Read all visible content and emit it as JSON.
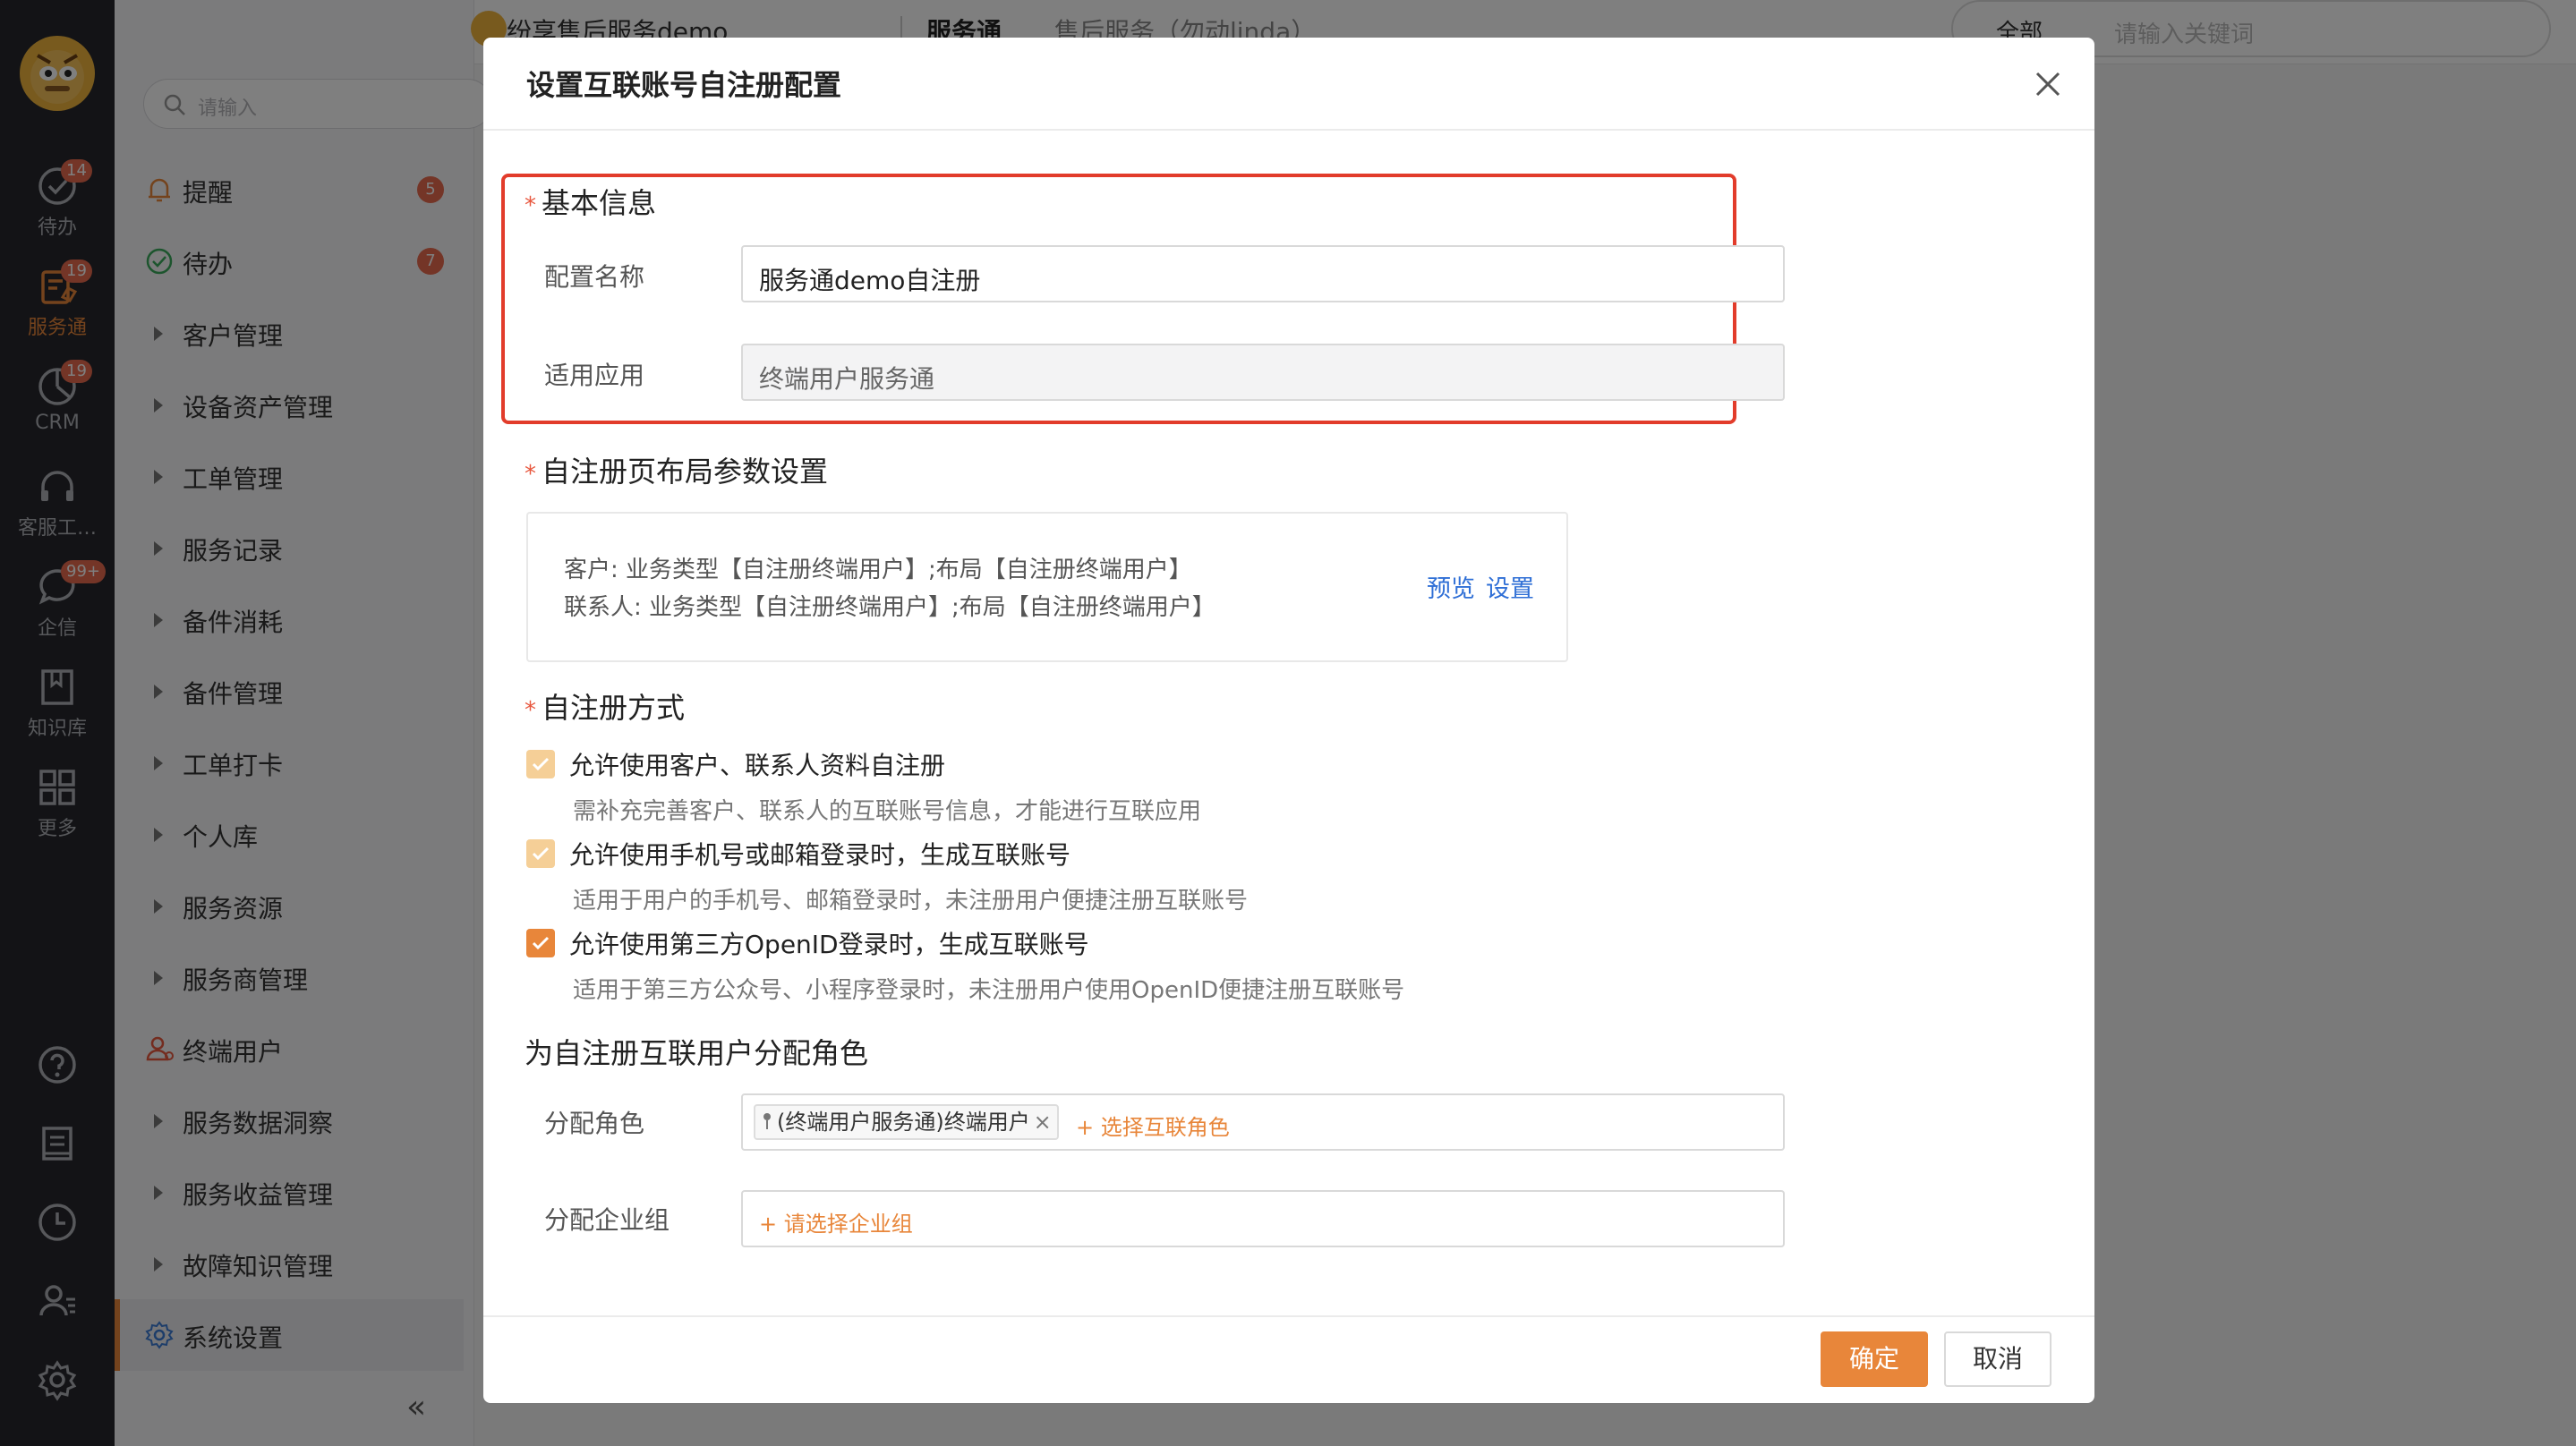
{
  "rail": {
    "items": [
      {
        "label": "待办",
        "badge": "14",
        "icon": "check-circle-icon"
      },
      {
        "label": "服务通",
        "badge": "19",
        "icon": "service-icon",
        "active": true
      },
      {
        "label": "CRM",
        "badge": "19",
        "icon": "pie-chart-icon"
      },
      {
        "label": "客服工…",
        "badge": "",
        "icon": "headset-icon"
      },
      {
        "label": "企信",
        "badge": "99+",
        "icon": "chat-bubble-icon"
      },
      {
        "label": "知识库",
        "badge": "",
        "icon": "book-icon"
      },
      {
        "label": "更多",
        "badge": "",
        "icon": "grid-icon"
      }
    ],
    "tools": [
      "help-icon",
      "notebook-icon",
      "clock-icon",
      "user-settings-icon",
      "gear-icon"
    ]
  },
  "side": {
    "search_placeholder": "请输入",
    "items": [
      {
        "label": "提醒",
        "badge": "5",
        "icon": "bell-icon"
      },
      {
        "label": "待办",
        "badge": "7",
        "icon": "check-circle-icon"
      },
      {
        "label": "客户管理"
      },
      {
        "label": "设备资产管理"
      },
      {
        "label": "工单管理"
      },
      {
        "label": "服务记录"
      },
      {
        "label": "备件消耗"
      },
      {
        "label": "备件管理"
      },
      {
        "label": "工单打卡"
      },
      {
        "label": "个人库"
      },
      {
        "label": "服务资源"
      },
      {
        "label": "服务商管理"
      },
      {
        "label": "终端用户",
        "icon": "user-icon"
      },
      {
        "label": "服务数据洞察"
      },
      {
        "label": "服务收益管理"
      },
      {
        "label": "故障知识管理"
      },
      {
        "label": "系统设置",
        "icon": "gear-icon",
        "active": true
      }
    ],
    "collapse_label": "«"
  },
  "topbar": {
    "org": "纷享售后服务demo",
    "app": "服务通",
    "dept": "售后服务（勿动linda）",
    "search_scope": "全部",
    "search_placeholder": "请输入关键词"
  },
  "dialog": {
    "title": "设置互联账号自注册配置",
    "basic": {
      "title": "基本信息",
      "name_label": "配置名称",
      "name_value": "服务通demo自注册",
      "app_label": "适用应用",
      "app_value": "终端用户服务通"
    },
    "layout": {
      "title": "自注册页布局参数设置",
      "line1": "客户: 业务类型【自注册终端用户】;布局【自注册终端用户】",
      "line2": "联系人: 业务类型【自注册终端用户】;布局【自注册终端用户】",
      "preview": "预览",
      "settings": "设置"
    },
    "method": {
      "title": "自注册方式",
      "options": [
        {
          "label": "允许使用客户、联系人资料自注册",
          "hint": "需补充完善客户、联系人的互联账号信息，才能进行互联应用",
          "checked": true,
          "disabled": true
        },
        {
          "label": "允许使用手机号或邮箱登录时，生成互联账号",
          "hint": "适用于用户的手机号、邮箱登录时，未注册用户便捷注册互联账号",
          "checked": true,
          "disabled": true
        },
        {
          "label": "允许使用第三方OpenID登录时，生成互联账号",
          "hint": "适用于第三方公众号、小程序登录时，未注册用户使用OpenID便捷注册互联账号",
          "checked": true,
          "disabled": false
        }
      ]
    },
    "roles": {
      "title": "为自注册互联用户分配角色",
      "role_label": "分配角色",
      "role_tag": "(终端用户服务通)终端用户",
      "role_add": "+ 选择互联角色",
      "group_label": "分配企业组",
      "group_add": "+ 请选择企业组"
    },
    "ok": "确定",
    "cancel": "取消"
  },
  "colors": {
    "accent": "#e8863a",
    "highlight": "#e23c2b",
    "link": "#2f6fd6",
    "badge": "#e86a4f"
  }
}
